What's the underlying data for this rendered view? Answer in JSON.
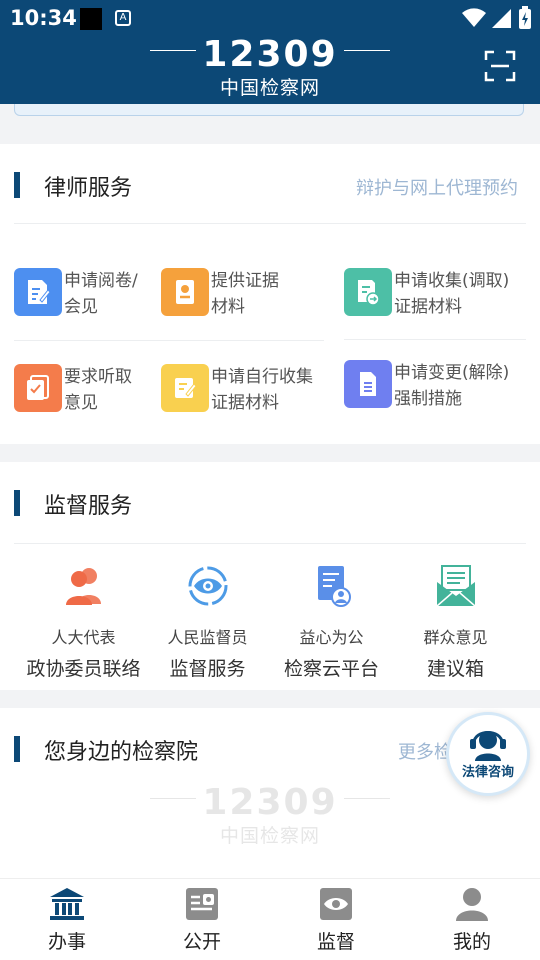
{
  "status_bar": {
    "time": "10:34",
    "a_badge": "A"
  },
  "header": {
    "logo_number": "12309",
    "logo_text": "中国检察网"
  },
  "lawyer": {
    "title": "律师服务",
    "link": "辩护与网上代理预约",
    "items": [
      {
        "line1": "申请阅卷/",
        "line2": "会见",
        "color": "#4d8ff0"
      },
      {
        "line1": "提供证据",
        "line2": "材料",
        "color": "#f5a13c"
      },
      {
        "line1": "申请收集(调取)",
        "line2": "证据材料",
        "color": "#4dbfa6"
      },
      {
        "line1": "要求听取",
        "line2": "意见",
        "color": "#f47c4b"
      },
      {
        "line1": "申请自行收集",
        "line2": "证据材料",
        "color": "#f9d04f"
      },
      {
        "line1": "申请变更(解除)",
        "line2": "强制措施",
        "color": "#6f7ff0"
      }
    ]
  },
  "supervision": {
    "title": "监督服务",
    "items": [
      {
        "line1": "人大代表",
        "line2": "政协委员联络",
        "icon": "people-icon",
        "color": "#ef6a47"
      },
      {
        "line1": "人民监督员",
        "line2": "监督服务",
        "icon": "eye-icon",
        "color": "#4d9be6"
      },
      {
        "line1": "益心为公",
        "line2": "检察云平台",
        "icon": "document-user-icon",
        "color": "#5a8fe8"
      },
      {
        "line1": "群众意见",
        "line2": "建议箱",
        "icon": "mailbox-icon",
        "color": "#43b39a"
      }
    ]
  },
  "nearby": {
    "title": "您身边的检察院",
    "link": "更多检"
  },
  "fab": {
    "label": "法律咨询"
  },
  "tabs": [
    {
      "label": "办事",
      "icon": "court-building-icon",
      "active": true
    },
    {
      "label": "公开",
      "icon": "public-icon",
      "active": false
    },
    {
      "label": "监督",
      "icon": "eye-tab-icon",
      "active": false
    },
    {
      "label": "我的",
      "icon": "person-icon",
      "active": false
    }
  ],
  "colors": {
    "brand": "#0c4876",
    "link": "#9eb7d3",
    "background": "#f2f3f5"
  }
}
